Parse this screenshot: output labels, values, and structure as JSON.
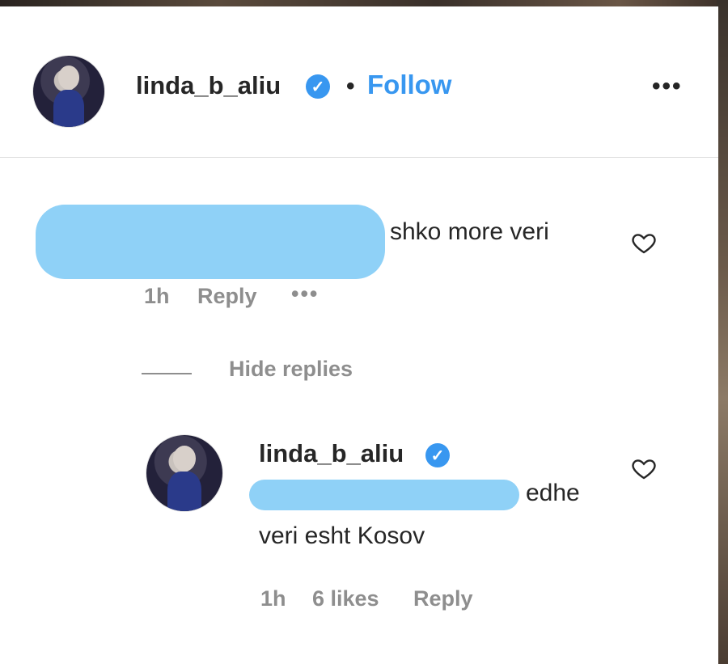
{
  "post_header": {
    "username": "linda_b_aliu",
    "separator": "•",
    "follow_label": "Follow",
    "more_label": "•••"
  },
  "comment": {
    "text": "shko more veri",
    "time": "1h",
    "reply_label": "Reply",
    "more_label": "•••",
    "hide_replies_label": "Hide replies"
  },
  "reply": {
    "username": "linda_b_aliu",
    "text_line1": "edhe",
    "text_line2": "veri esht Kosov",
    "time": "1h",
    "likes": "6 likes",
    "reply_label": "Reply"
  },
  "colors": {
    "accent": "#3897f0",
    "redaction": "#8fd1f7",
    "meta_text": "#8e8e8e"
  },
  "icons": [
    "verified-badge-icon",
    "heart-icon",
    "more-options-icon"
  ]
}
